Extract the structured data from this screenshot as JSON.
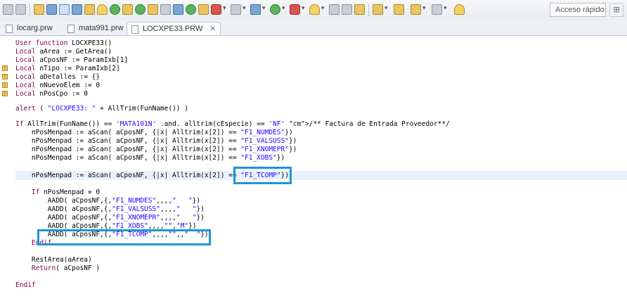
{
  "toolbar": {
    "quick_access_placeholder": "Acceso rápido",
    "icons": [
      "new-file-icon",
      "save-icon",
      "print-icon",
      "properties-icon",
      "compile-icon",
      "build-icon",
      "chart-icon",
      "filter-icon",
      "settings-icon",
      "connect-icon",
      "search-icon",
      "merge-icon",
      "compare-icon",
      "remote-icon",
      "run-icon",
      "debug-icon",
      "coverage-icon",
      "stop-icon",
      "link-icon",
      "target-icon",
      "step-icon",
      "bug-icon",
      "play-icon",
      "profile-icon",
      "marker-icon",
      "box-icon",
      "list-icon",
      "pin-icon",
      "arrow-icon",
      "back-icon",
      "forward-icon",
      "pencil-icon"
    ],
    "accent": "#1e95d3"
  },
  "tabs": [
    {
      "label": "locarg.prw",
      "active": false
    },
    {
      "label": "mata991.prw",
      "active": false
    },
    {
      "label": "LOCXPE33.PRW",
      "active": true
    }
  ],
  "editor": {
    "lines": [
      {
        "t": "User function LOCXPE33()"
      },
      {
        "t": "Local aArea := GetArea()"
      },
      {
        "t": "Local aCposNF := ParamIxb[1]"
      },
      {
        "t": "Local nTipo := ParamIxb[2]"
      },
      {
        "t": "Local aDetalles := {}"
      },
      {
        "t": "Local nNuevoElem := 0"
      },
      {
        "t": "Local nPosCpo := 0"
      },
      {
        "t": ""
      },
      {
        "t": "alert ( \"LOCXPE33: \" + AllTrim(FunName()) )"
      },
      {
        "t": ""
      },
      {
        "t": "If AllTrim(FunName()) == 'MATA101N' .and. alltrim(cEspecie) == 'NF' /** Factura de Entrada Proveedor**/"
      },
      {
        "t": "    nPosMenpad := aScan( aCposNF, {|x| Alltrim(x[2]) == \"F1_NUMDES\"})"
      },
      {
        "t": "    nPosMenpad := aScan( aCposNF, {|x| Alltrim(x[2]) == \"F1_VALSUSS\"})"
      },
      {
        "t": "    nPosMenpad := aScan( aCposNF, {|x| Alltrim(x[2]) == \"F1_XNOMEPR\"})"
      },
      {
        "t": "    nPosMenpad := aScan( aCposNF, {|x| Alltrim(x[2]) == \"F1_XOBS\"})"
      },
      {
        "t": ""
      },
      {
        "t": "    nPosMenpad := aScan( aCposNF, {|x| Alltrim(x[2]) == \"F1_TCOMP\"})"
      },
      {
        "t": ""
      },
      {
        "t": "    If nPosMenpad = 0"
      },
      {
        "t": "        AADD( aCposNF,{,\"F1_NUMDES\",,,,\"   \"})"
      },
      {
        "t": "        AADD( aCposNF,{,\"F1_VALSUSS\",,,,\"   \"})"
      },
      {
        "t": "        AADD( aCposNF,{,\"F1_XNOMEPR\",,,,\"   \"})"
      },
      {
        "t": "        AADD( aCposNF,{,\"F1_XOBS\",,,,\"\",\"M\"})"
      },
      {
        "t": "        AADD( aCposNF,{,\"F1_TCOMP\",,,,\"\",,\"  \"})"
      },
      {
        "t": "    Endif"
      },
      {
        "t": ""
      },
      {
        "t": "    RestArea(aArea)"
      },
      {
        "t": "    Return( aCposNF )"
      },
      {
        "t": ""
      },
      {
        "t": "Endif"
      }
    ]
  }
}
